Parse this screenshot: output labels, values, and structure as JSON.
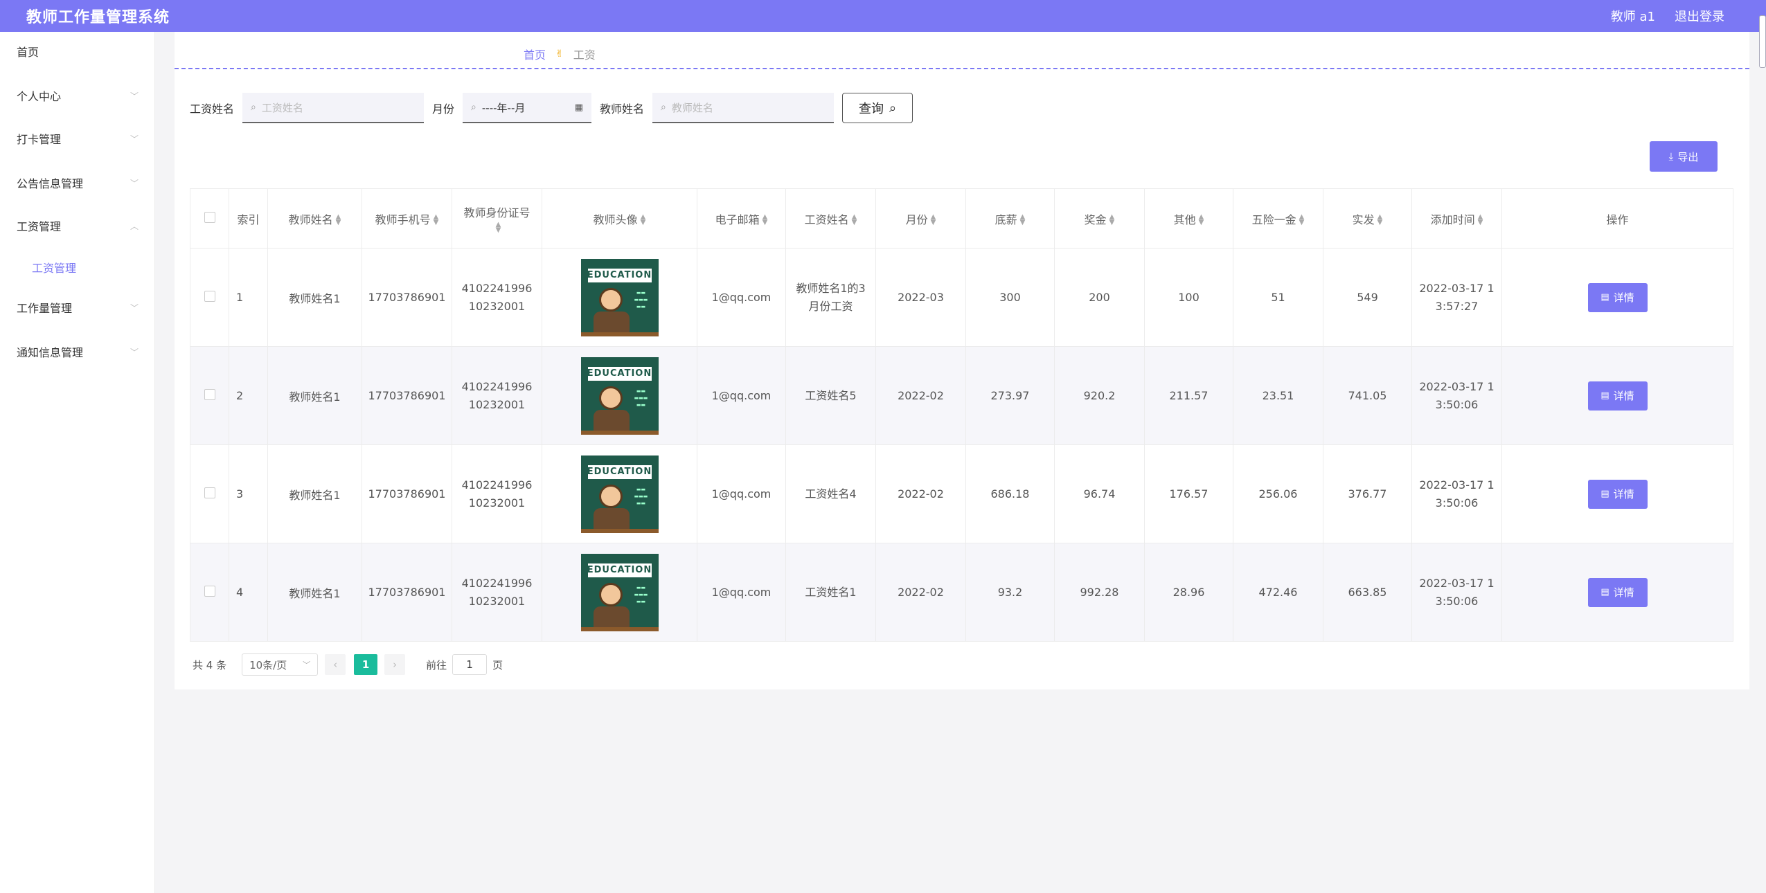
{
  "app_title": "教师工作量管理系统",
  "header": {
    "user": "教师 a1",
    "logout": "退出登录"
  },
  "sidebar": {
    "items": [
      {
        "label": "首页",
        "chevron": false
      },
      {
        "label": "个人中心",
        "chevron": true
      },
      {
        "label": "打卡管理",
        "chevron": true
      },
      {
        "label": "公告信息管理",
        "chevron": true
      },
      {
        "label": "工资管理",
        "chevron": true,
        "open": true
      },
      {
        "label": "工作量管理",
        "chevron": true
      },
      {
        "label": "通知信息管理",
        "chevron": true
      }
    ],
    "sub_item": "工资管理"
  },
  "breadcrumb": {
    "home": "首页",
    "current": "工资"
  },
  "search": {
    "salary_name_label": "工资姓名",
    "salary_name_placeholder": "工资姓名",
    "month_label": "月份",
    "month_placeholder": "----年--月",
    "teacher_name_label": "教师姓名",
    "teacher_name_placeholder": "教师姓名",
    "query_label": "查询"
  },
  "export_label": "导出",
  "table": {
    "headers": [
      "索引",
      "教师姓名",
      "教师手机号",
      "教师身份证号",
      "教师头像",
      "电子邮箱",
      "工资姓名",
      "月份",
      "底薪",
      "奖金",
      "其他",
      "五险一金",
      "实发",
      "添加时间",
      "操作"
    ],
    "rows": [
      {
        "index": "1",
        "teacher": "教师姓名1",
        "phone": "17703786901",
        "id_card": "410224199610232001",
        "email": "1@qq.com",
        "salary_name": "教师姓名1的3月份工资",
        "month": "2022-03",
        "base": "300",
        "bonus": "200",
        "other": "100",
        "insurance": "51",
        "net": "549",
        "added": "2022-03-17 13:57:27"
      },
      {
        "index": "2",
        "teacher": "教师姓名1",
        "phone": "17703786901",
        "id_card": "410224199610232001",
        "email": "1@qq.com",
        "salary_name": "工资姓名5",
        "month": "2022-02",
        "base": "273.97",
        "bonus": "920.2",
        "other": "211.57",
        "insurance": "23.51",
        "net": "741.05",
        "added": "2022-03-17 13:50:06"
      },
      {
        "index": "3",
        "teacher": "教师姓名1",
        "phone": "17703786901",
        "id_card": "410224199610232001",
        "email": "1@qq.com",
        "salary_name": "工资姓名4",
        "month": "2022-02",
        "base": "686.18",
        "bonus": "96.74",
        "other": "176.57",
        "insurance": "256.06",
        "net": "376.77",
        "added": "2022-03-17 13:50:06"
      },
      {
        "index": "4",
        "teacher": "教师姓名1",
        "phone": "17703786901",
        "id_card": "410224199610232001",
        "email": "1@qq.com",
        "salary_name": "工资姓名1",
        "month": "2022-02",
        "base": "93.2",
        "bonus": "992.28",
        "other": "28.96",
        "insurance": "472.46",
        "net": "663.85",
        "added": "2022-03-17 13:50:06"
      }
    ],
    "detail_label": "详情",
    "avatar_text": "EDUCATION"
  },
  "pager": {
    "total": "共 4 条",
    "page_size": "10条/页",
    "current_page": "1",
    "goto_prefix": "前往",
    "goto_value": "1",
    "goto_suffix": "页"
  },
  "colors": {
    "accent": "#7b78f4",
    "page_active": "#1abc9c"
  }
}
